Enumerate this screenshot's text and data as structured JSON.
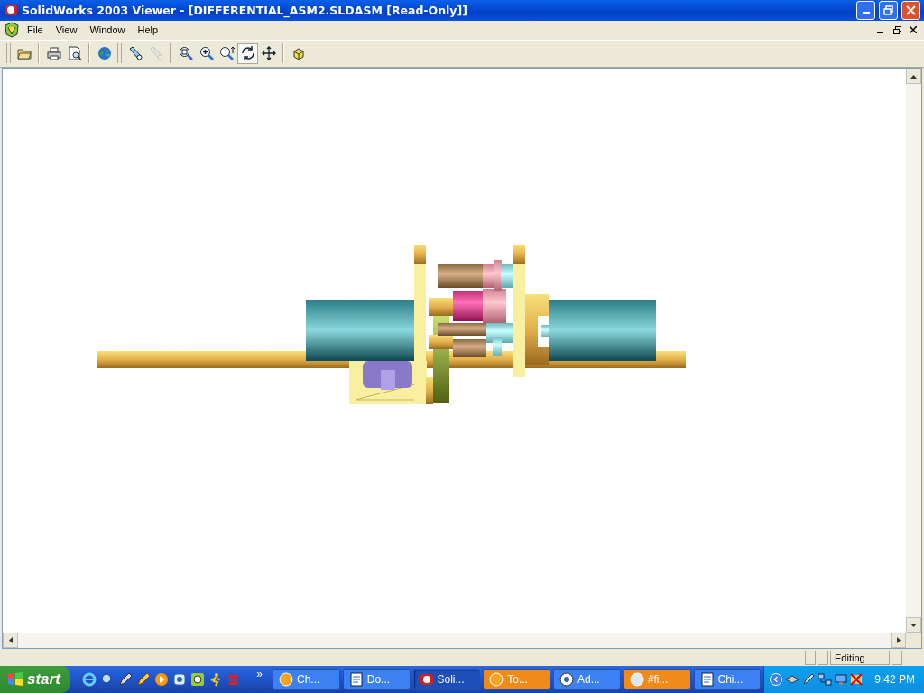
{
  "window": {
    "title": "SolidWorks 2003 Viewer - [DIFFERENTIAL_ASM2.SLDASM [Read-Only]]"
  },
  "menu": [
    "File",
    "View",
    "Window",
    "Help"
  ],
  "toolbar": [
    [
      {
        "kind": "open",
        "selected": false,
        "disabled": false
      }
    ],
    [
      {
        "kind": "print",
        "selected": false,
        "disabled": false
      },
      {
        "kind": "preview",
        "selected": false,
        "disabled": false
      }
    ],
    [
      {
        "kind": "web",
        "selected": false,
        "disabled": false
      }
    ],
    [
      {
        "kind": "light",
        "selected": false,
        "disabled": false
      },
      {
        "kind": "light",
        "selected": false,
        "disabled": true
      }
    ],
    [
      {
        "kind": "zoomfit",
        "selected": false,
        "disabled": false
      },
      {
        "kind": "zoomin",
        "selected": false,
        "disabled": false
      },
      {
        "kind": "zoomarea",
        "selected": false,
        "disabled": false
      },
      {
        "kind": "rotate",
        "selected": true,
        "disabled": false
      },
      {
        "kind": "pan",
        "selected": false,
        "disabled": false
      }
    ],
    [
      {
        "kind": "shaded",
        "selected": false,
        "disabled": false
      }
    ]
  ],
  "status_bar": {
    "mode": "Editing"
  },
  "taskbar": {
    "start": "start",
    "quick_launch": [
      {
        "kind": "ie"
      },
      {
        "kind": "search"
      },
      {
        "kind": "pen"
      },
      {
        "kind": "pen2"
      },
      {
        "kind": "media"
      },
      {
        "kind": "app"
      },
      {
        "kind": "clock"
      },
      {
        "kind": "runner"
      },
      {
        "kind": "bars"
      }
    ],
    "more": "»",
    "tasks": [
      {
        "label": "Ch...",
        "kind": "orb",
        "selected": false,
        "flashing": false
      },
      {
        "label": "Do...",
        "kind": "doc",
        "selected": false,
        "flashing": false
      },
      {
        "label": "Soli...",
        "kind": "sw",
        "selected": true,
        "flashing": false
      },
      {
        "label": "To...",
        "kind": "orb",
        "selected": false,
        "flashing": true
      },
      {
        "label": "Ad...",
        "kind": "app",
        "selected": false,
        "flashing": false
      },
      {
        "label": "#fi...",
        "kind": "orbw",
        "selected": false,
        "flashing": true
      },
      {
        "label": "Chi...",
        "kind": "doc",
        "selected": false,
        "flashing": false
      }
    ],
    "clock": "9:42 PM"
  }
}
